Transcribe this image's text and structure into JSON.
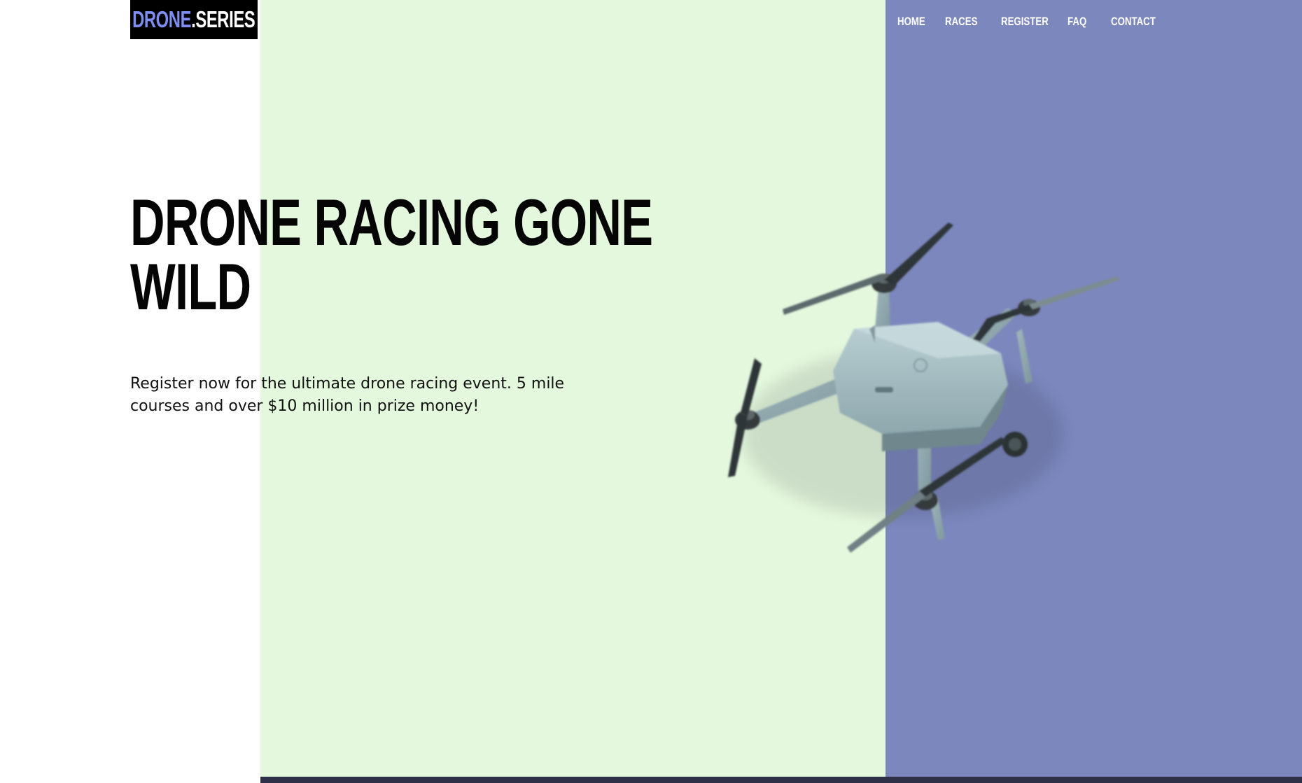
{
  "logo": {
    "part_a": "DRONE",
    "part_b": ".SERIES"
  },
  "nav": {
    "items": [
      {
        "label": "HOME"
      },
      {
        "label": "RACES"
      },
      {
        "label": "REGISTER"
      },
      {
        "label": "FAQ"
      },
      {
        "label": "CONTACT"
      }
    ]
  },
  "hero": {
    "title_line1": "DRONE RACING GONE",
    "title_line2": "WILD",
    "subtitle": "Register now for the ultimate drone racing event. 5 mile courses and over $10 million in prize money!"
  },
  "colors": {
    "accent_blue": "#7f8cf0",
    "panel_green": "#e4f8de",
    "panel_purple": "#7c87bd",
    "bottom_bar": "#2d3047"
  },
  "icons": {
    "hero_image": "drone-icon"
  }
}
